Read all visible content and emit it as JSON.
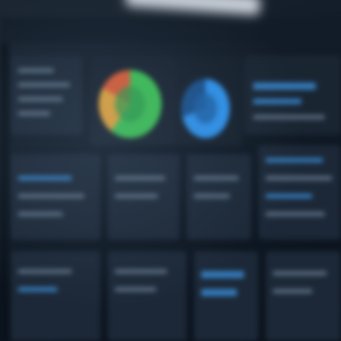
{
  "screen": {
    "description_visible_text": ""
  },
  "charts": {
    "left_donut": {
      "segments": [
        {
          "color": "#3bbd52",
          "fraction": 0.6
        },
        {
          "color": "#e0a13a",
          "fraction": 0.24
        },
        {
          "color": "#d65a35",
          "fraction": 0.16
        }
      ]
    },
    "right_donut": {
      "segments": [
        {
          "color": "#2e8fe6",
          "fraction": 0.7
        },
        {
          "color": "#1a4f8a",
          "fraction": 0.3
        }
      ]
    }
  },
  "colors": {
    "background": "#0c141e",
    "panel": "#1c2837",
    "accent_blue": "#2e8fe6",
    "accent_green": "#3bbd52"
  }
}
